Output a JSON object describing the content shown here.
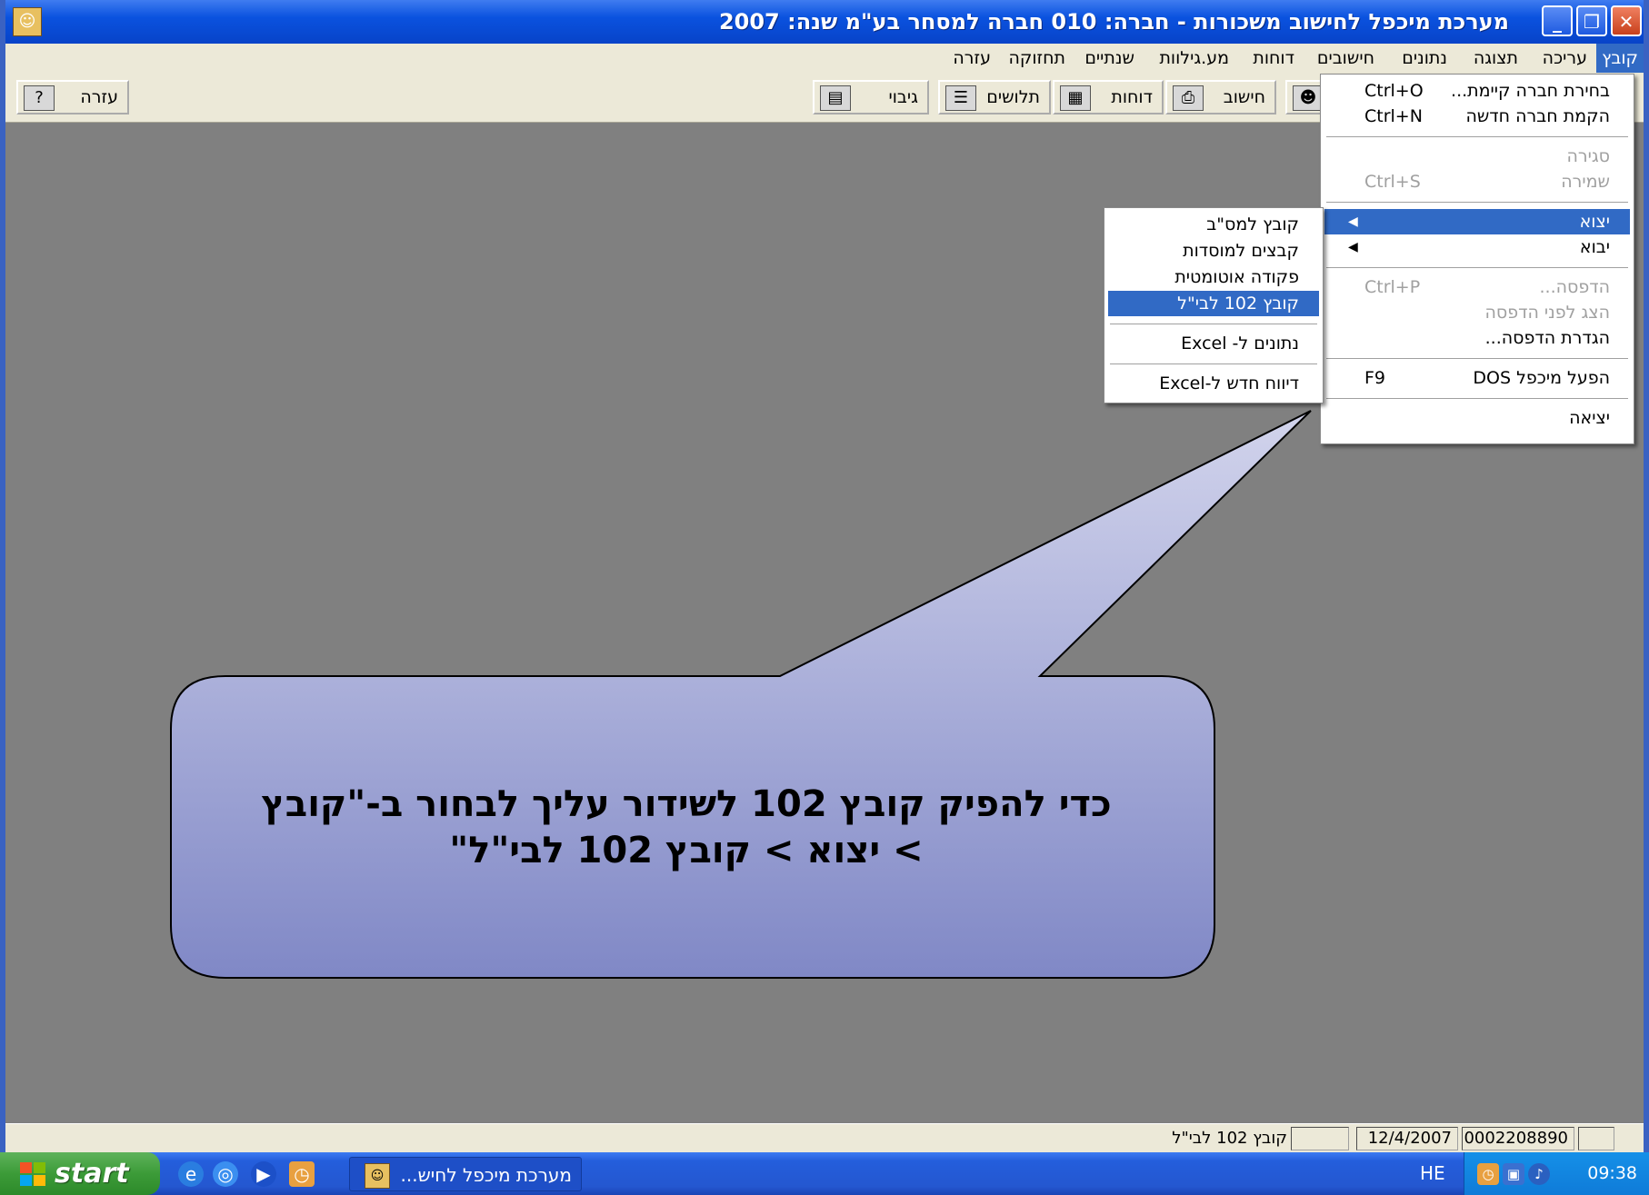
{
  "window": {
    "title": "מערכת מיכפל לחישוב משכורות - חברה: 010 חברה למסחר בע\"מ שנה: 2007",
    "minimize": "_",
    "restore": "❐",
    "close": "✕"
  },
  "menubar": {
    "file": "קובץ",
    "edit": "עריכה",
    "view": "תצוגה",
    "data": "נתונים",
    "calcs": "חישובים",
    "reports": "דוחות",
    "sheets": "מע.גילוות",
    "yearly": "שנתיים",
    "maintenance": "תחזוקה",
    "help": "עזרה"
  },
  "toolbar": {
    "help": "עזרה",
    "backup": "גיבוי",
    "payslips": "תלושים",
    "reports": "דוחות",
    "calc": "חישוב"
  },
  "file_menu": {
    "select_company": "בחירת חברה קיימת...",
    "select_company_sc": "Ctrl+O",
    "new_company": "הקמת חברה חדשה",
    "new_company_sc": "Ctrl+N",
    "close": "סגירה",
    "save": "שמירה",
    "save_sc": "Ctrl+S",
    "export": "יצוא",
    "import": "יבוא",
    "print": "הדפסה...",
    "print_sc": "Ctrl+P",
    "print_preview": "הצג לפני הדפסה",
    "print_setup": "הגדרת הדפסה...",
    "run_dos": "הפעל מיכפל DOS",
    "run_dos_sc": "F9",
    "exit": "יציאה"
  },
  "export_menu": {
    "tax_file": "קובץ למס\"ב",
    "institutions": "קבצים למוסדות",
    "auto_command": "פקודה אוטומטית",
    "file_102": "קובץ 102 לבי\"ל",
    "data_excel": "נתונים ל- Excel",
    "new_report_excel": "דיווח חדש ל-Excel"
  },
  "callout": {
    "line1": "כדי להפיק קובץ 102 לשידור עליך לבחור ב-\"קובץ",
    "line2": "> יצוא > קובץ 102 לבי\"ל\""
  },
  "statusbar": {
    "message": "קובץ 102 לבי\"ל",
    "date": "12/4/2007",
    "code": "0002208890"
  },
  "taskbar": {
    "start": "start",
    "task": "מערכת מיכפל לחיש...",
    "lang": "HE",
    "clock": "09:38"
  },
  "colors": {
    "highlight": "#316ac5",
    "callout_top": "#d2d4ec",
    "callout_bottom": "#8088c6"
  }
}
